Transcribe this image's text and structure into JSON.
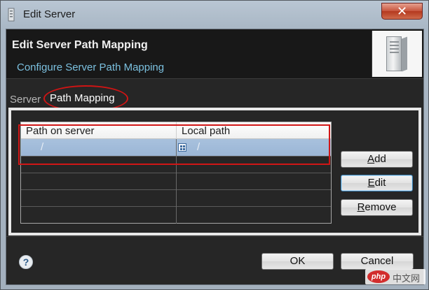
{
  "window": {
    "title": "Edit Server",
    "close_glyph": "✕"
  },
  "header": {
    "title": "Edit Server Path Mapping",
    "subtitle": "Configure Server Path Mapping",
    "image": "server-tower-icon"
  },
  "tabs": [
    {
      "label": "Server",
      "selected": false
    },
    {
      "label": "Path Mapping",
      "selected": true
    }
  ],
  "table": {
    "columns": [
      "Path on server",
      "Local path"
    ],
    "rows": [
      {
        "path_on_server": "/",
        "local_path": "/",
        "selected": true
      }
    ]
  },
  "buttons": {
    "add": {
      "mnemonic": "A",
      "rest": "dd"
    },
    "edit": {
      "mnemonic": "E",
      "rest": "dit"
    },
    "remove": {
      "mnemonic": "R",
      "rest": "emove"
    }
  },
  "footer": {
    "help": "?",
    "ok": "OK",
    "cancel": "Cancel"
  },
  "watermark": {
    "logo": "php",
    "text": "中文网"
  },
  "colors": {
    "highlight_ring": "#d01414",
    "selection": "#a8c1dd",
    "subtitle": "#7bc0df"
  }
}
